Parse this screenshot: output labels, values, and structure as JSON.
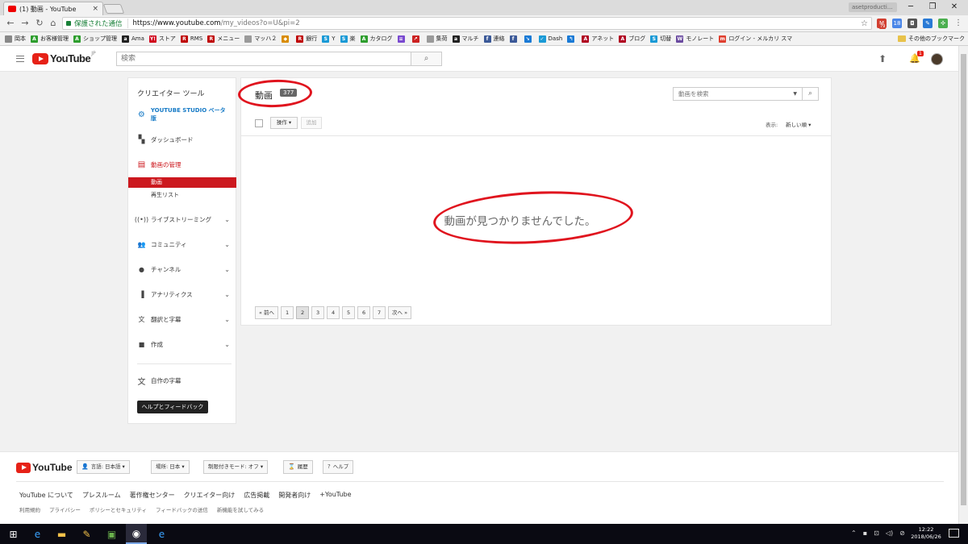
{
  "browser": {
    "tab_title": "(1) 動画 - YouTube",
    "tab_close": "×",
    "window_user": "asetproducti...",
    "win_min": "─",
    "win_max": "❐",
    "win_close": "✕",
    "secure_label": "保護された通信",
    "url_host": "https://www.youtube.com",
    "url_path": "/my_videos?o=U&pi=2",
    "bookmarks": [
      {
        "label": "岡本",
        "icon": "bookmark-icon",
        "color": "#888888",
        "glyph": ""
      },
      {
        "label": "お客様管理",
        "icon": "a-icon",
        "color": "#2e9e2e",
        "glyph": "A"
      },
      {
        "label": "ショップ管理",
        "icon": "a-icon",
        "color": "#2e9e2e",
        "glyph": "A"
      },
      {
        "label": "Ama",
        "icon": "amazon-icon",
        "color": "#222222",
        "glyph": "a"
      },
      {
        "label": "ストア",
        "icon": "yahoo-icon",
        "color": "#d0021b",
        "glyph": "Y!"
      },
      {
        "label": "RMS",
        "icon": "rakuten-icon",
        "color": "#bf0000",
        "glyph": "R"
      },
      {
        "label": "メニュー",
        "icon": "rakuten-icon",
        "color": "#bf0000",
        "glyph": "R"
      },
      {
        "label": "マッハ２",
        "icon": "page-icon",
        "color": "#9a9a9a",
        "glyph": ""
      },
      {
        "label": "",
        "icon": "diamond-icon",
        "color": "#d98c00",
        "glyph": "◆"
      },
      {
        "label": "銀行",
        "icon": "rakuten-icon",
        "color": "#bf0000",
        "glyph": "R"
      },
      {
        "label": "Y",
        "icon": "s-icon",
        "color": "#1a9ad6",
        "glyph": "S"
      },
      {
        "label": "楽",
        "icon": "s-icon",
        "color": "#1a9ad6",
        "glyph": "S"
      },
      {
        "label": "カタログ",
        "icon": "a-icon",
        "color": "#2e9e2e",
        "glyph": "A"
      },
      {
        "label": "",
        "icon": "logo-icon",
        "color": "#7a4ad0",
        "glyph": "≡"
      },
      {
        "label": "",
        "icon": "chart-icon",
        "color": "#cc2222",
        "glyph": "↗"
      },
      {
        "label": "集荷",
        "icon": "page-icon",
        "color": "#9a9a9a",
        "glyph": ""
      },
      {
        "label": "マルチ",
        "icon": "amazon-icon",
        "color": "#222222",
        "glyph": "a"
      },
      {
        "label": "連絡",
        "icon": "facebook-icon",
        "color": "#3b5998",
        "glyph": "f"
      },
      {
        "label": "",
        "icon": "facebook-icon",
        "color": "#3b5998",
        "glyph": "f"
      },
      {
        "label": "",
        "icon": "chart-icon",
        "color": "#1a7ad6",
        "glyph": "↘"
      },
      {
        "label": "Dash",
        "icon": "check-icon",
        "color": "#1a9ad6",
        "glyph": "✓"
      },
      {
        "label": "",
        "icon": "arrow-icon",
        "color": "#1a7ad6",
        "glyph": "↰"
      },
      {
        "label": "アネット",
        "icon": "a-icon",
        "color": "#b00020",
        "glyph": "A"
      },
      {
        "label": "ブログ",
        "icon": "a-icon",
        "color": "#b00020",
        "glyph": "A"
      },
      {
        "label": "切替",
        "icon": "s-icon",
        "color": "#1a9ad6",
        "glyph": "S"
      },
      {
        "label": "モノレート",
        "icon": "bars-icon",
        "color": "#6a4aa0",
        "glyph": "W"
      },
      {
        "label": "ログイン - メルカリ スマ",
        "icon": "mercari-icon",
        "color": "#e04030",
        "glyph": "m"
      }
    ],
    "other_bookmarks": "その他のブックマーク",
    "extension_badge": "79"
  },
  "header": {
    "logo_text": "YouTube",
    "logo_region": "JP",
    "search_placeholder": "検索",
    "notification_count": "1"
  },
  "sidebar": {
    "title": "クリエイター ツール",
    "studio_label": "YOUTUBE STUDIO ベータ版",
    "dashboard": "ダッシュボード",
    "video_manager": "動画の管理",
    "sub_videos": "動画",
    "sub_playlists": "再生リスト",
    "items": [
      {
        "label": "ライブストリーミング",
        "icon": "live-icon",
        "glyph": "((•))"
      },
      {
        "label": "コミュニティ",
        "icon": "community-icon",
        "glyph": "👥"
      },
      {
        "label": "チャンネル",
        "icon": "channel-icon",
        "glyph": "●"
      },
      {
        "label": "アナリティクス",
        "icon": "analytics-icon",
        "glyph": "▐"
      },
      {
        "label": "翻訳と字幕",
        "icon": "translate-icon",
        "glyph": "文"
      },
      {
        "label": "作成",
        "icon": "camera-icon",
        "glyph": "■"
      }
    ],
    "own_subtitles": "自作の字幕",
    "help_button": "ヘルプとフィードバック"
  },
  "main": {
    "title": "動画",
    "count": "377",
    "search_placeholder": "動画を検索",
    "actions_button": "操作 ▾",
    "add_button": "追加",
    "sort_label": "表示:",
    "sort_value": "新しい順 ▾",
    "empty_message": "動画が見つかりませんでした。",
    "pagination": [
      {
        "label": "« 前へ",
        "current": false
      },
      {
        "label": "1",
        "current": false
      },
      {
        "label": "2",
        "current": true
      },
      {
        "label": "3",
        "current": false
      },
      {
        "label": "4",
        "current": false
      },
      {
        "label": "5",
        "current": false
      },
      {
        "label": "6",
        "current": false
      },
      {
        "label": "7",
        "current": false
      },
      {
        "label": "次へ »",
        "current": false
      }
    ]
  },
  "footer": {
    "logo_text": "YouTube",
    "language_button": "言語: 日本語 ▾",
    "location_button": "場所: 日本 ▾",
    "restricted_button": "制限付きモード: オフ ▾",
    "history_button": "履歴",
    "help_button": "ヘルプ",
    "links_primary": [
      "YouTube について",
      "プレスルーム",
      "著作権センター",
      "クリエイター向け",
      "広告掲載",
      "開発者向け",
      "+YouTube"
    ],
    "links_secondary": [
      "利用規約",
      "プライバシー",
      "ポリシーとセキュリティ",
      "フィードバックの送信",
      "新機能を試してみる"
    ]
  },
  "taskbar": {
    "time": "12:22",
    "date": "2018/06/26"
  },
  "colors": {
    "youtube_red": "#e62117",
    "annotation_red": "#e0141e",
    "studio_blue": "#167ac6",
    "active_red": "#cc181e"
  }
}
